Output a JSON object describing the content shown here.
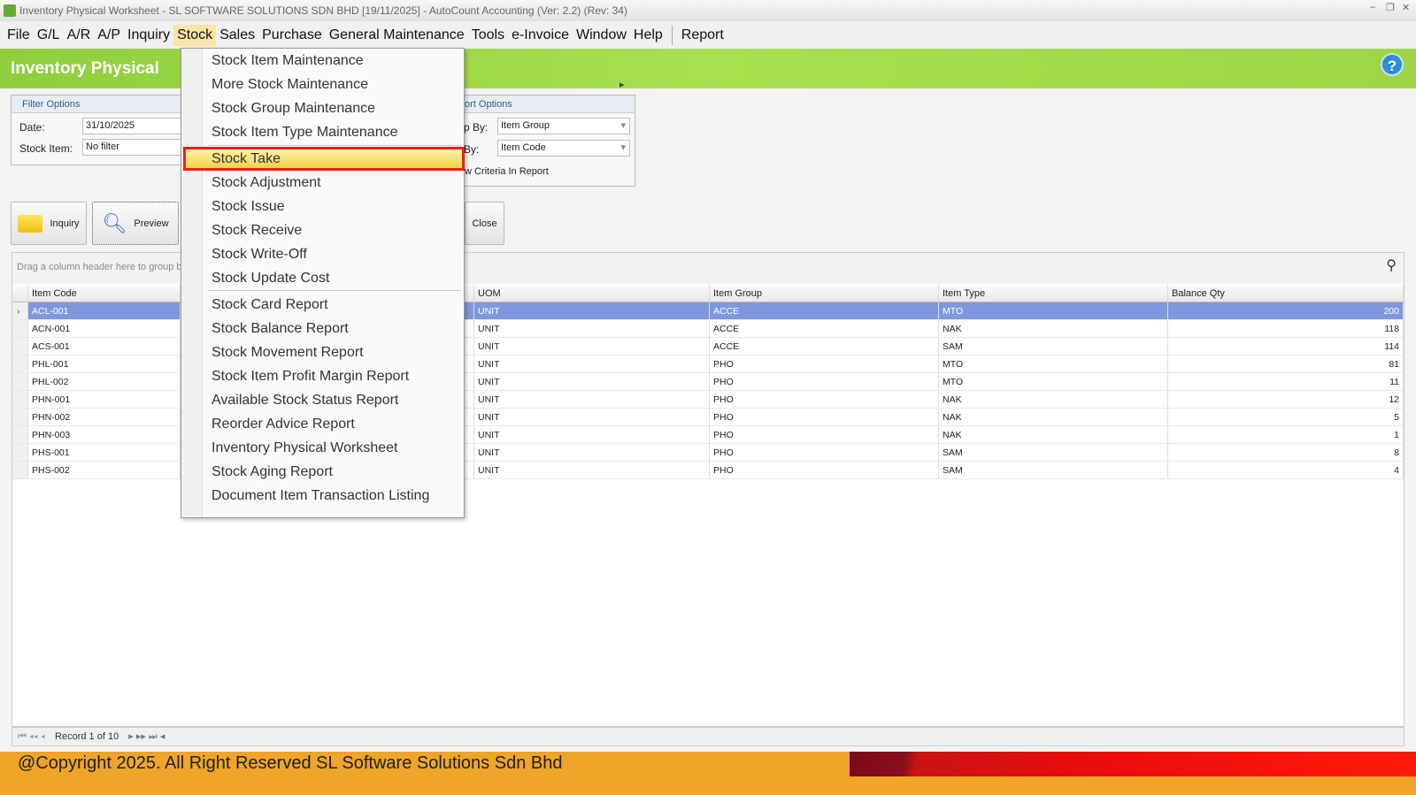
{
  "window": {
    "title": "Inventory Physical Worksheet - SL SOFTWARE SOLUTIONS SDN BHD [19/11/2025] - AutoCount Accounting (Ver: 2.2) (Rev: 34)"
  },
  "menubar": {
    "items": [
      "File",
      "G/L",
      "A/R",
      "A/P",
      "Inquiry",
      "Stock",
      "Sales",
      "Purchase",
      "General Maintenance",
      "Tools",
      "e-Invoice",
      "Window",
      "Help"
    ],
    "report": "Report",
    "active": "Stock"
  },
  "header": {
    "title": "Inventory Physical",
    "help_icon": "?"
  },
  "filter": {
    "title": "Filter Options",
    "date_label": "Date:",
    "date_value": "31/10/2025",
    "stock_item_label": "Stock Item:",
    "stock_item_value": "No filter"
  },
  "report_options": {
    "title": "ort Options",
    "group_by_label": "p By:",
    "group_by_value": "Item Group",
    "sort_by_label": "By:",
    "sort_by_value": "Item Code",
    "criteria_label": "w Criteria In Report"
  },
  "toolbar": {
    "inquiry": "Inquiry",
    "preview": "Preview",
    "close": "Close"
  },
  "grid": {
    "group_hint": "Drag a column header here to group by",
    "columns": [
      "Item Code",
      "UOM",
      "Item Group",
      "Item Type",
      "Balance Qty"
    ],
    "rows": [
      [
        "ACL-001",
        "UNIT",
        "ACCE",
        "MTO",
        "200"
      ],
      [
        "ACN-001",
        "UNIT",
        "ACCE",
        "NAK",
        "118"
      ],
      [
        "ACS-001",
        "UNIT",
        "ACCE",
        "SAM",
        "114"
      ],
      [
        "PHL-001",
        "UNIT",
        "PHO",
        "MTO",
        "81"
      ],
      [
        "PHL-002",
        "UNIT",
        "PHO",
        "MTO",
        "11"
      ],
      [
        "PHN-001",
        "UNIT",
        "PHO",
        "NAK",
        "12"
      ],
      [
        "PHN-002",
        "UNIT",
        "PHO",
        "NAK",
        "5"
      ],
      [
        "PHN-003",
        "UNIT",
        "PHO",
        "NAK",
        "1"
      ],
      [
        "PHS-001",
        "UNIT",
        "PHO",
        "SAM",
        "8"
      ],
      [
        "PHS-002",
        "UNIT",
        "PHO",
        "SAM",
        "4"
      ]
    ],
    "pager": "Record 1 of 10"
  },
  "stock_menu": {
    "items": [
      "Stock Item Maintenance",
      "More Stock Maintenance",
      "Stock Group Maintenance",
      "Stock Item Type Maintenance",
      "Stock Take",
      "Stock Adjustment",
      "Stock Issue",
      "Stock Receive",
      "Stock Write-Off",
      "Stock Update Cost",
      "Stock Card Report",
      "Stock Balance Report",
      "Stock Movement Report",
      "Stock Item Profit Margin Report",
      "Available Stock Status Report",
      "Reorder Advice Report",
      "Inventory Physical Worksheet",
      "Stock Aging Report",
      "Document Item Transaction Listing"
    ],
    "highlighted": "Stock Take"
  },
  "footer": {
    "copyright": "@Copyright 2025. All Right Reserved SL Software Solutions Sdn Bhd"
  }
}
